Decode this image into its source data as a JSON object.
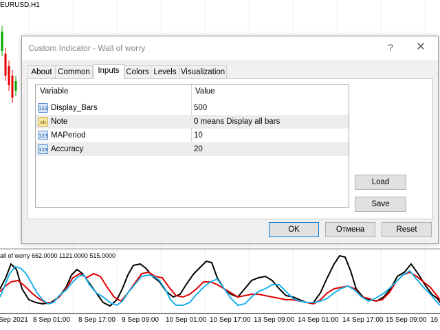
{
  "chart": {
    "symbol": "EURUSD,H1",
    "indicator_label": "all of worry 662.0000 1121.0000 515.0000",
    "dates": [
      "Sep 2021",
      "8 Sep 01:00",
      "8 Sep 17:00",
      "9 Sep 09:00",
      "10 Sep 01:00",
      "10 Sep 17:00",
      "13 Sep 09:00",
      "14 Sep 01:00",
      "14 Sep 17:00",
      "15 Sep 09:00",
      "16 S"
    ],
    "series_colors": {
      "black": "#000000",
      "red": "#e00000",
      "blue": "#1ab0e8"
    },
    "candle_colors": {
      "bull": "#00aa00",
      "bear": "#e60000"
    }
  },
  "dialog": {
    "title": "Custom Indicator - Wall of worry",
    "help_label": "?",
    "close_label": "✕",
    "tabs": [
      "About",
      "Common",
      "Inputs",
      "Colors",
      "Levels",
      "Visualization"
    ],
    "active_tab": "Inputs",
    "grid": {
      "headers": {
        "variable": "Variable",
        "value": "Value"
      },
      "rows": [
        {
          "icon": "123",
          "name": "Display_Bars",
          "value": "500"
        },
        {
          "icon": "ab",
          "name": "Note",
          "value": "0 means Display all bars"
        },
        {
          "icon": "123",
          "name": "MAPeriod",
          "value": "10"
        },
        {
          "icon": "123",
          "name": "Accuracy",
          "value": "20"
        }
      ]
    },
    "buttons": {
      "load": "Load",
      "save": "Save",
      "ok": "OK",
      "cancel": "Отмена",
      "reset": "Reset"
    }
  }
}
